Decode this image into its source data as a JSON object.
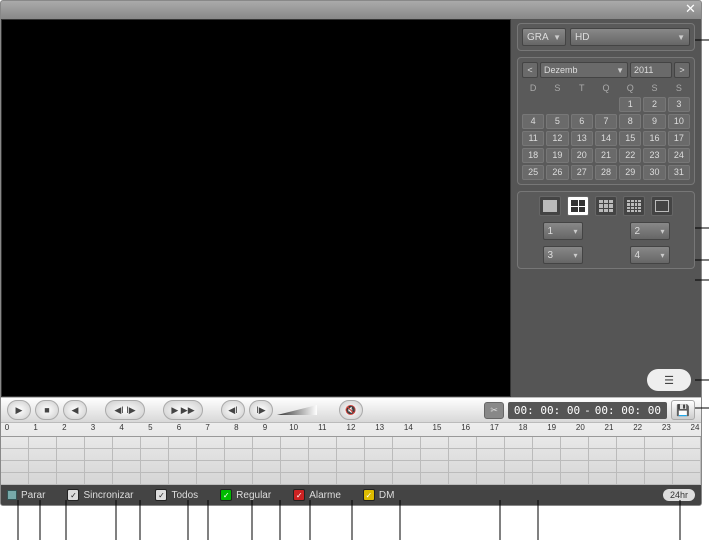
{
  "source_dropdowns": {
    "type_label": "GRA",
    "storage_label": "HD"
  },
  "calendar": {
    "month_label": "Dezemb",
    "year_label": "2011",
    "dow": [
      "D",
      "S",
      "T",
      "Q",
      "Q",
      "S",
      "S"
    ],
    "days": [
      "",
      "",
      "",
      "",
      "1",
      "2",
      "3",
      "4",
      "5",
      "6",
      "7",
      "8",
      "9",
      "10",
      "11",
      "12",
      "13",
      "14",
      "15",
      "16",
      "17",
      "18",
      "19",
      "20",
      "21",
      "22",
      "23",
      "24",
      "25",
      "26",
      "27",
      "28",
      "29",
      "30",
      "31"
    ]
  },
  "channels": [
    "1",
    "2",
    "3",
    "4"
  ],
  "playback": {
    "time_start": "00: 00: 00",
    "time_end": "00: 00: 00",
    "time_sep": "-",
    "cut_label": "✂"
  },
  "ruler_hours": [
    "0",
    "1",
    "2",
    "3",
    "4",
    "5",
    "6",
    "7",
    "8",
    "9",
    "10",
    "11",
    "12",
    "13",
    "14",
    "15",
    "16",
    "17",
    "18",
    "19",
    "20",
    "21",
    "22",
    "23",
    "24"
  ],
  "bottom": {
    "stop_label": "Parar",
    "sync_label": "Sincronizar",
    "all_label": "Todos",
    "regular_label": "Regular",
    "alarm_label": "Alarme",
    "motion_label": "DM",
    "scale_label": "24hr"
  }
}
